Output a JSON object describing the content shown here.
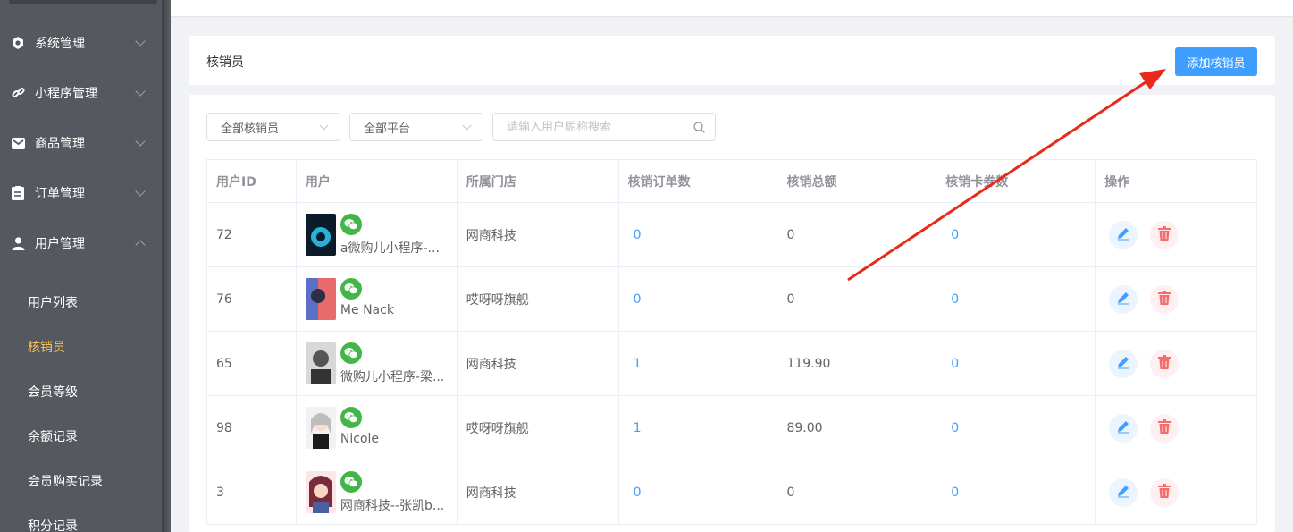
{
  "sidebar": {
    "groups": [
      {
        "label": "系统管理",
        "icon": "gear-icon"
      },
      {
        "label": "小程序管理",
        "icon": "link-icon"
      },
      {
        "label": "商品管理",
        "icon": "mail-icon"
      },
      {
        "label": "订单管理",
        "icon": "clipboard-icon"
      },
      {
        "label": "用户管理",
        "icon": "user-icon"
      }
    ],
    "sub_items": [
      {
        "label": "用户列表"
      },
      {
        "label": "核销员"
      },
      {
        "label": "会员等级"
      },
      {
        "label": "余额记录"
      },
      {
        "label": "会员购买记录"
      },
      {
        "label": "积分记录"
      }
    ],
    "active_color": "#f5c253"
  },
  "title_card": {
    "title": "核销员",
    "add_button": "添加核销员"
  },
  "filters": {
    "verifier_select": "全部核销员",
    "platform_select": "全部平台",
    "search_placeholder": "请输入用户昵称搜索"
  },
  "table": {
    "headers": [
      "用户ID",
      "用户",
      "所属门店",
      "核销订单数",
      "核销总额",
      "核销卡券数",
      "操作"
    ],
    "rows": [
      {
        "id": "72",
        "name": "a微购儿小程序-...",
        "store": "网商科技",
        "orders": "0",
        "total": "0",
        "cards": "0"
      },
      {
        "id": "76",
        "name": "Me Nack",
        "store": "哎呀呀旗舰",
        "orders": "0",
        "total": "0",
        "cards": "0"
      },
      {
        "id": "65",
        "name": "微购儿小程序-梁...",
        "store": "网商科技",
        "orders": "1",
        "total": "119.90",
        "cards": "0"
      },
      {
        "id": "98",
        "name": "Nicole",
        "store": "哎呀呀旗舰",
        "orders": "1",
        "total": "89.00",
        "cards": "0"
      },
      {
        "id": "3",
        "name": "网商科技--张凯b...",
        "store": "网商科技",
        "orders": "0",
        "total": "0",
        "cards": "0"
      }
    ]
  },
  "colors": {
    "primary": "#409eff",
    "wechat": "#44b549",
    "danger": "#f56c6c",
    "annotation_arrow": "#e8291c"
  }
}
